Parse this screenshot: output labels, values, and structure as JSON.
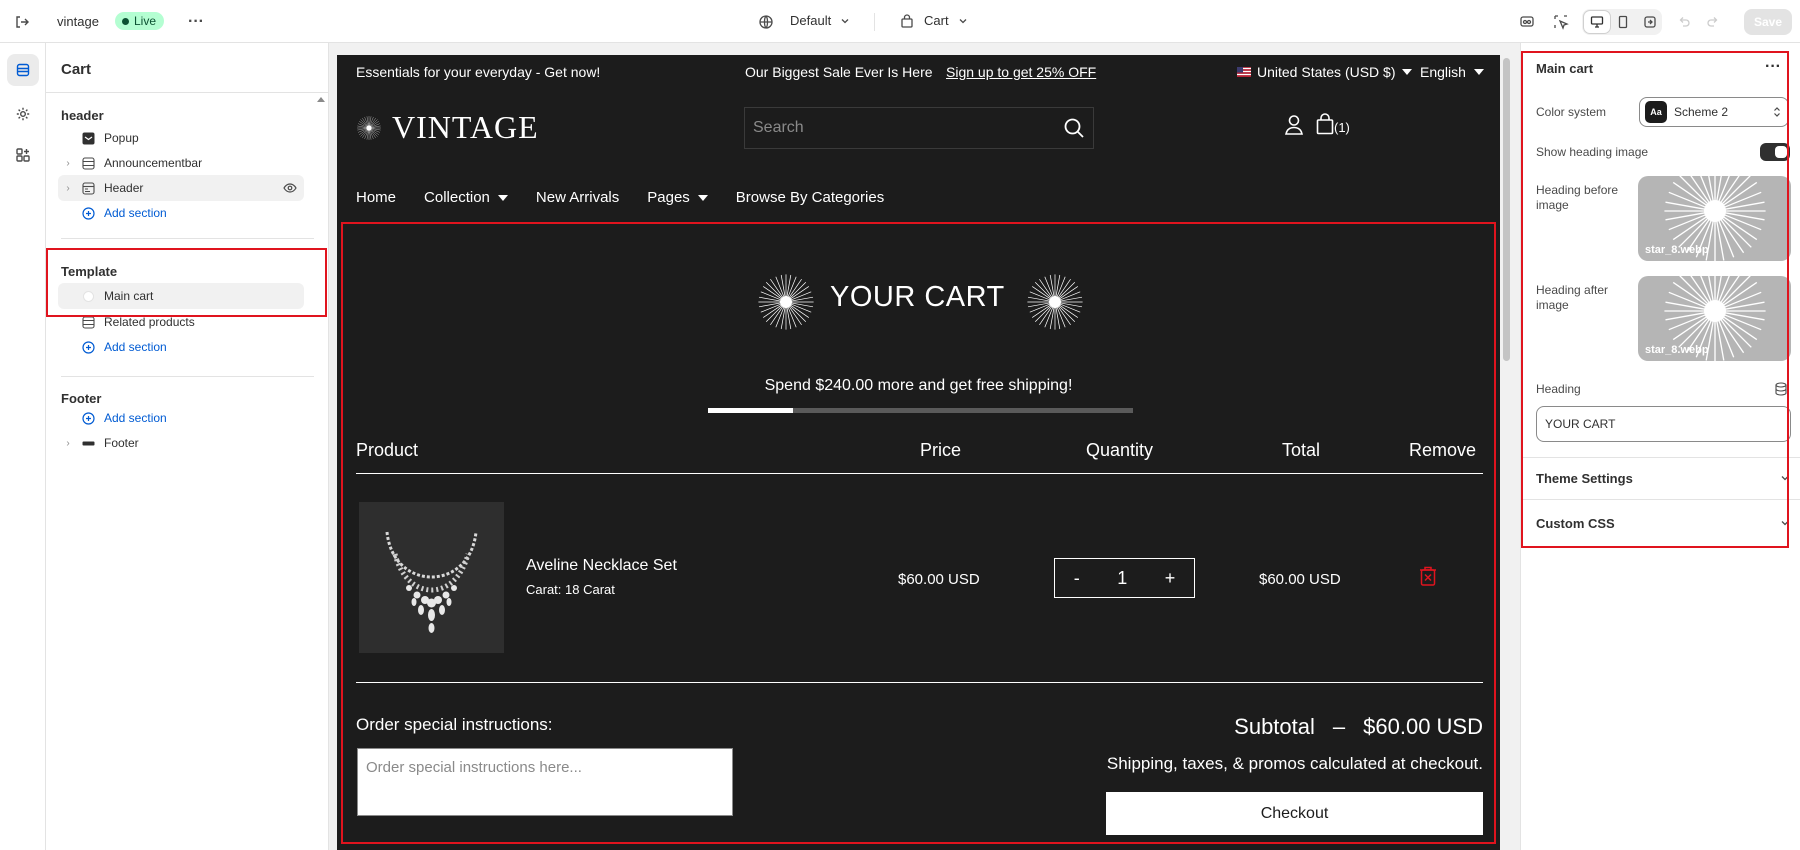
{
  "topbar": {
    "store_name": "vintage",
    "status": "Live",
    "theme_select": "Default",
    "page_select": "Cart",
    "save_label": "Save"
  },
  "left_panel": {
    "title": "Cart",
    "header_group": "header",
    "header_items": [
      "Popup",
      "Announcementbar",
      "Header"
    ],
    "template_group": "Template",
    "template_items": [
      "Main cart",
      "Related products"
    ],
    "footer_group": "Footer",
    "footer_items": [
      "Footer"
    ],
    "add_section": "Add section"
  },
  "preview": {
    "announcement_left": "Essentials for your everyday - Get now!",
    "announcement_center": "Our Biggest Sale Ever Is Here",
    "announcement_link": "Sign up to get 25% OFF",
    "currency": "United States (USD $)",
    "language": "English",
    "logo": "VINTAGE",
    "search_placeholder": "Search",
    "cart_count": "(1)",
    "nav": [
      "Home",
      "Collection",
      "New Arrivals",
      "Pages",
      "Browse By Categories"
    ],
    "cart_heading": "YOUR CART",
    "shipping_message": "Spend $240.00 more and get free shipping!",
    "shipping_progress": 0.2,
    "columns": [
      "Product",
      "Price",
      "Quantity",
      "Total",
      "Remove"
    ],
    "item": {
      "name": "Aveline Necklace Set",
      "variant": "Carat: 18 Carat",
      "price": "$60.00 USD",
      "quantity": "1",
      "total": "$60.00 USD"
    },
    "qty_minus": "-",
    "qty_plus": "+",
    "notes_label": "Order special instructions:",
    "notes_placeholder": "Order special instructions here...",
    "subtotal_label": "Subtotal",
    "subtotal_sep": "–",
    "subtotal_value": "$60.00 USD",
    "shipping_note": "Shipping, taxes, & promos calculated at checkout.",
    "checkout": "Checkout"
  },
  "right_panel": {
    "title": "Main cart",
    "color_system_label": "Color system",
    "color_scheme": "Scheme 2",
    "scheme_badge": "Aa",
    "show_heading_image_label": "Show heading image",
    "show_heading_image": true,
    "heading_before_label": "Heading before image",
    "heading_before_file": "star_8.webp",
    "heading_after_label": "Heading after image",
    "heading_after_file": "star_8.webp",
    "heading_label": "Heading",
    "heading_value": "YOUR CART",
    "theme_settings": "Theme Settings",
    "custom_css": "Custom CSS"
  },
  "colors": {
    "accent_red": "#e0141e",
    "link_blue": "#005bd3",
    "live_bg": "#b4fed2",
    "canvas_bg": "#1c1c1c"
  }
}
